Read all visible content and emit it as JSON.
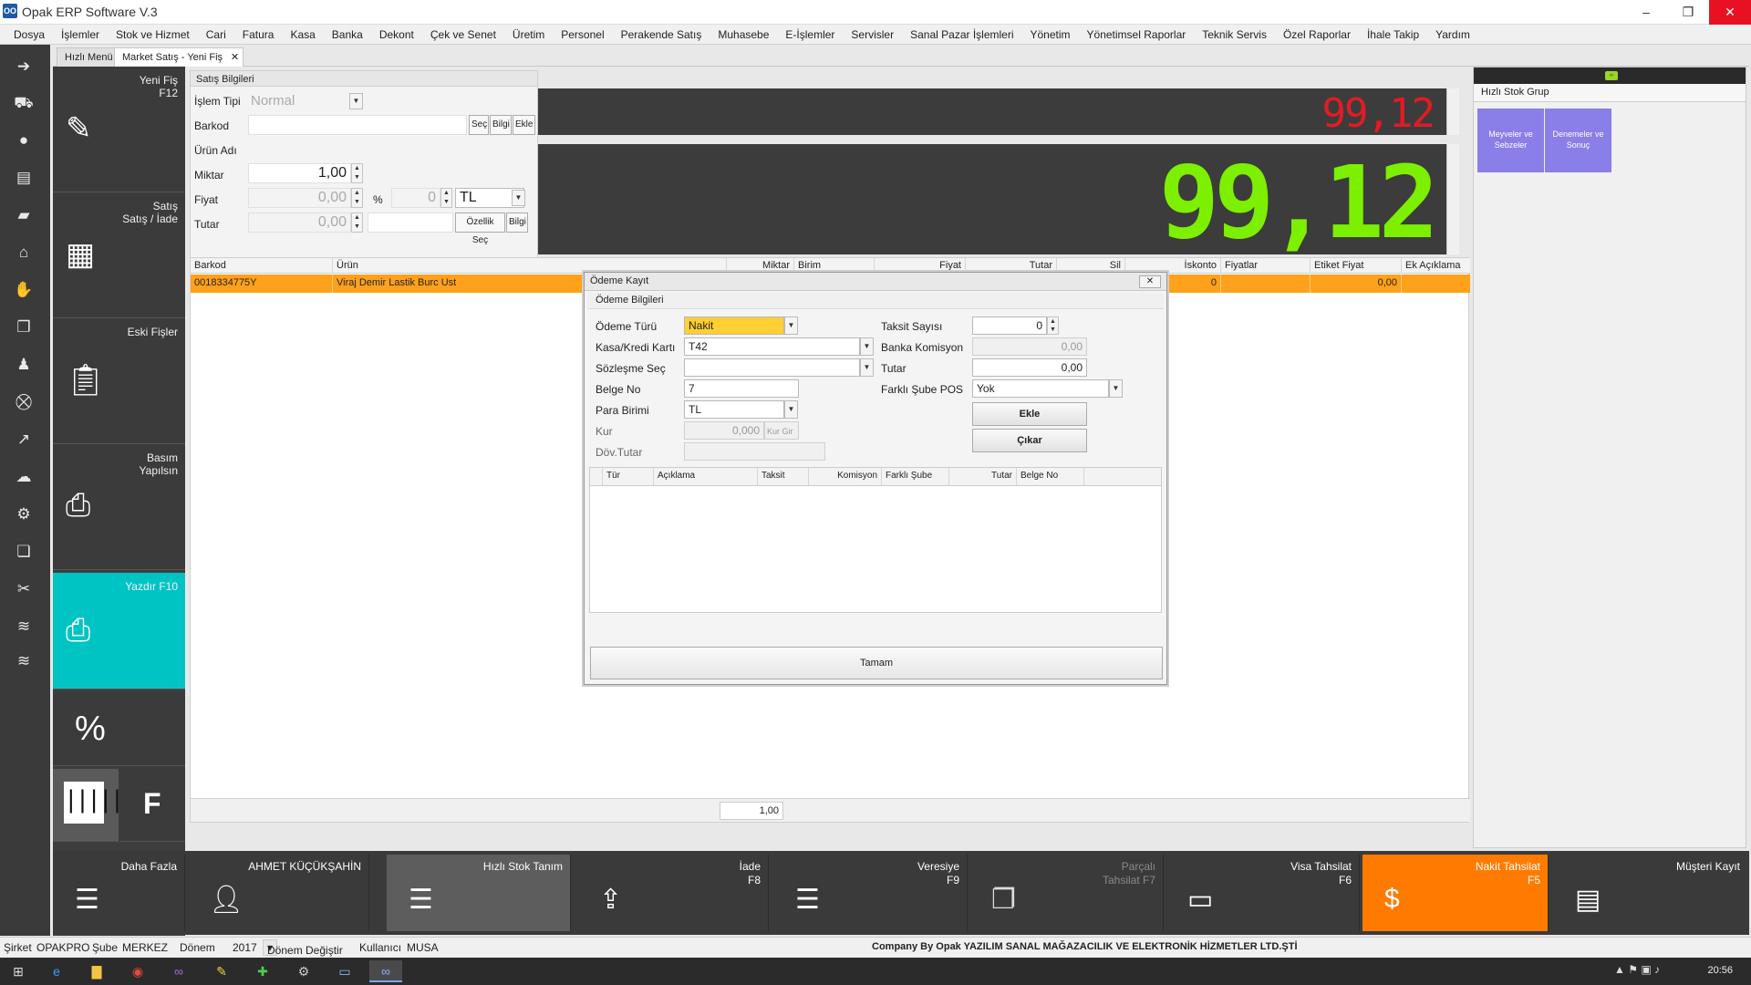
{
  "app": {
    "title": "Opak ERP Software V.3",
    "logo_text": "OO"
  },
  "window_controls": {
    "minimize": "–",
    "restore": "❐",
    "close": "✕"
  },
  "menu": [
    "Dosya",
    "İşlemler",
    "Stok ve Hizmet",
    "Cari",
    "Fatura",
    "Kasa",
    "Banka",
    "Dekont",
    "Çek ve Senet",
    "Üretim",
    "Personel",
    "Perakende Satış",
    "Muhasebe",
    "E-İşlemler",
    "Servisler",
    "Sanal Pazar İşlemleri",
    "Yönetim",
    "Yönetimsel Raporlar",
    "Teknik Servis",
    "Özel Raporlar",
    "İhale Takip",
    "Yardım"
  ],
  "tabs": [
    {
      "label": "Hızlı Menü"
    },
    {
      "label": "Market Satış - Yeni Fiş"
    }
  ],
  "tab_close": "✕",
  "tiles": {
    "new_receipt": "Yeni Fiş\nF12",
    "sales_return": "Satış\nSatış / İade",
    "old_receipts": "Eski Fişler",
    "print_done": "Basım\nYapılsın",
    "print": "Yazdır F10",
    "percent": "%",
    "f_key": "F"
  },
  "sales_info": {
    "header": "Satış Bilgileri",
    "labels": {
      "islem_tipi": "İşlem Tipi",
      "barkod": "Barkod",
      "urun_adi": "Ürün Adı",
      "miktar": "Miktar",
      "fiyat": "Fiyat",
      "tutar": "Tutar",
      "percent": "%"
    },
    "values": {
      "islem_tipi": "Normal",
      "barkod": "",
      "miktar": "1,00",
      "fiyat": "0,00",
      "iskonto": "0",
      "currency": "TL",
      "tutar": "0,00"
    },
    "buttons": {
      "sec": "Seç",
      "bilgi": "Bilgi",
      "ekle": "Ekle",
      "ozellik_sec": "Özellik Seç",
      "bilgi2": "Bilgi"
    }
  },
  "displays": {
    "small": "99,12",
    "big": "99,12"
  },
  "grid": {
    "headers": [
      "Barkod",
      "Ürün",
      "Miktar",
      "Birim",
      "Fiyat",
      "Tutar",
      "Sil",
      "İskonto",
      "Fiyatlar",
      "Etiket Fiyat",
      "Ek Açıklama"
    ],
    "rows": [
      {
        "barkod": "0018334775Y",
        "urun": "Viraj Demir Lastik Burc Ust",
        "iskonto": "0",
        "etiket_fiyat": "0,00"
      }
    ],
    "footer_qty": "1,00"
  },
  "right_panel": {
    "header": "Hızlı Stok Grup",
    "groups": [
      "Meyveler ve Sebzeler",
      "Denemeler ve Sonuç"
    ]
  },
  "dialog": {
    "title": "Ödeme Kayıt",
    "close": "✕",
    "section": "Ödeme Bilgileri",
    "labels": {
      "odeme_turu": "Ödeme Türü",
      "kasa_kredi": "Kasa/Kredi Kartı",
      "sozlesme": "Sözleşme Seç",
      "belge_no": "Belge No",
      "para_birimi": "Para Birimi",
      "kur": "Kur",
      "dov_tutar": "Döv.Tutar",
      "taksit_sayisi": "Taksit Sayısı",
      "banka_komisyon": "Banka Komisyon",
      "tutar": "Tutar",
      "farkli_sube_pos": "Farklı Şube POS"
    },
    "values": {
      "odeme_turu": "Nakit",
      "kasa_kredi": "T42",
      "sozlesme": "",
      "belge_no": "7",
      "para_birimi": "TL",
      "kur": "0,000",
      "dov_tutar": "",
      "taksit_sayisi": "0",
      "banka_komisyon": "0,00",
      "tutar": "0,00",
      "farkli_sube_pos": "Yok"
    },
    "buttons": {
      "kur_gir": "Kur Gir",
      "ekle": "Ekle",
      "cikar": "Çıkar",
      "tamam": "Tamam"
    },
    "grid_headers": [
      "Tür",
      "Açıklama",
      "Taksit",
      "Komisyon",
      "Farklı Şube",
      "Tutar",
      "Belge No"
    ]
  },
  "actions": [
    {
      "label": "Daha Fazla"
    },
    {
      "label": "AHMET KÜÇÜKŞAHİN"
    },
    {
      "label": "Hızlı Stok Tanım"
    },
    {
      "label": "İade\nF8"
    },
    {
      "label": "Veresiye\nF9"
    },
    {
      "label": "Parçalı\nTahsilat F7"
    },
    {
      "label": "Visa Tahsilat\nF6"
    },
    {
      "label": "Nakit Tahsilat\nF5"
    },
    {
      "label": "Müşteri Kayıt"
    }
  ],
  "status": {
    "sirket_label": "Şirket",
    "sirket": "OPAKPRO",
    "sube_label": "Şube",
    "sube": "MERKEZ",
    "donem_label": "Dönem",
    "donem": "2017",
    "donem_degistir": "Dönem Değiştir",
    "kullanici_label": "Kullanıcı",
    "kullanici": "MUSA",
    "company": "Company By Opak YAZILIM SANAL MAĞAZACILIK VE ELEKTRONİK HİZMETLER LTD.ŞTİ"
  },
  "taskbar": {
    "clock": "20:56"
  },
  "colors": {
    "accent_teal": "#00c4c4",
    "accent_orange": "#ff7b00",
    "display_red": "#e31b23",
    "display_green": "#7cf000",
    "selected_row": "#ffa11a",
    "group_purple": "#8a7ee8"
  }
}
